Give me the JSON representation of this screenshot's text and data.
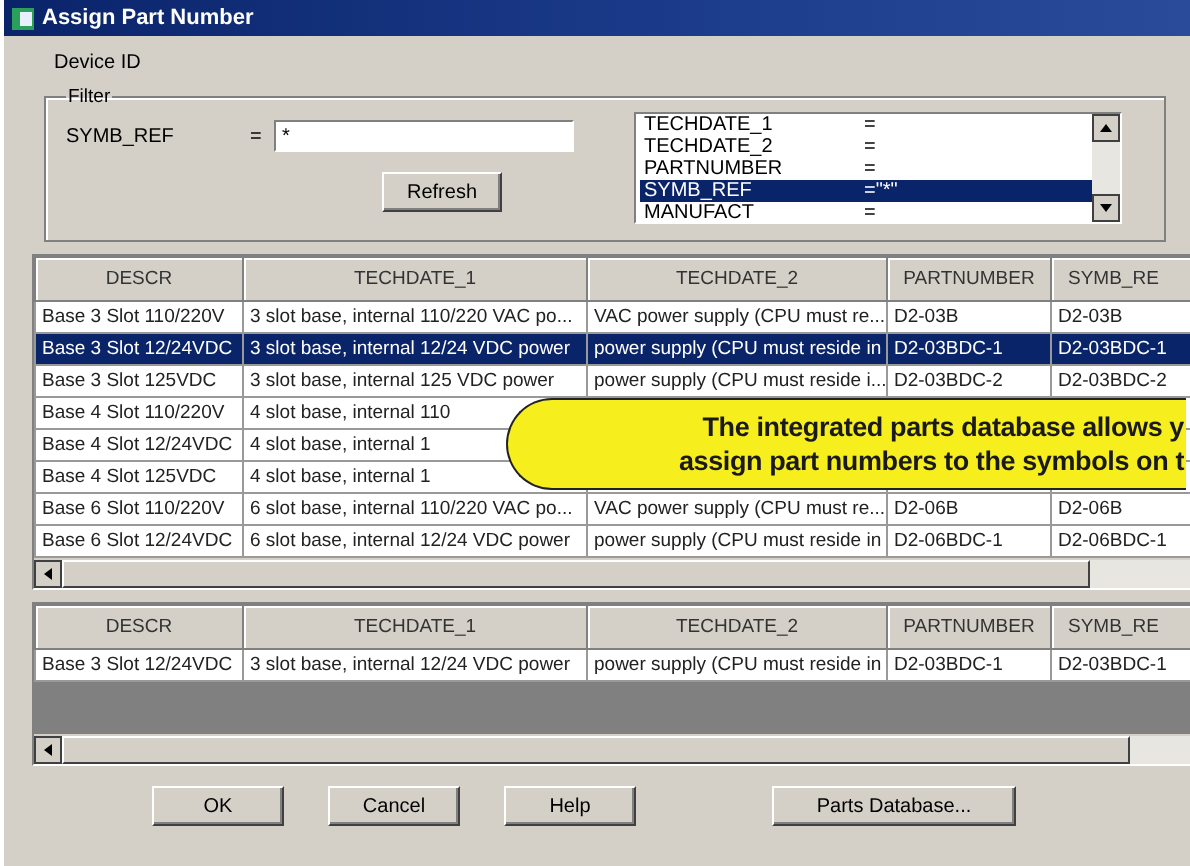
{
  "window": {
    "title": "Assign Part Number"
  },
  "device_id_label": "Device ID",
  "filter": {
    "title": "Filter",
    "field_label": "SYMB_REF",
    "equals": "=",
    "value": "*",
    "refresh_button": "Refresh",
    "conditions": [
      {
        "name": "TECHDATE_1",
        "operator": "=",
        "selected": false
      },
      {
        "name": "TECHDATE_2",
        "operator": "=",
        "selected": false
      },
      {
        "name": "PARTNUMBER",
        "operator": "=",
        "selected": false
      },
      {
        "name": "SYMB_REF",
        "operator": "=\"*\"",
        "selected": true
      },
      {
        "name": "MANUFACT",
        "operator": "=",
        "selected": false
      }
    ]
  },
  "parts_table": {
    "columns": [
      "DESCR",
      "TECHDATE_1",
      "TECHDATE_2",
      "PARTNUMBER",
      "SYMB_RE"
    ],
    "rows": [
      {
        "cells": [
          "Base 3 Slot 110/220V",
          "3 slot base, internal 110/220 VAC po...",
          "VAC power supply (CPU must re...",
          "D2-03B",
          "D2-03B"
        ],
        "selected": false
      },
      {
        "cells": [
          "Base 3 Slot 12/24VDC",
          "3 slot base, internal 12/24 VDC power",
          "power supply (CPU must reside in",
          "D2-03BDC-1",
          "D2-03BDC-1"
        ],
        "selected": true
      },
      {
        "cells": [
          "Base 3 Slot 125VDC",
          "3 slot base, internal 125 VDC power",
          "power supply (CPU must reside i...",
          "D2-03BDC-2",
          "D2-03BDC-2"
        ],
        "selected": false
      },
      {
        "cells": [
          "Base 4 Slot 110/220V",
          "4 slot base, internal 110"
        ],
        "selected": false
      },
      {
        "cells": [
          "Base 4 Slot 12/24VDC",
          "4 slot base, internal 1"
        ],
        "selected": false
      },
      {
        "cells": [
          "Base 4 Slot 125VDC",
          "4 slot base, internal 1"
        ],
        "selected": false
      },
      {
        "cells": [
          "Base 6 Slot 110/220V",
          "6 slot base, internal 110/220 VAC po...",
          "VAC power supply (CPU must re...",
          "D2-06B",
          "D2-06B"
        ],
        "selected": false
      },
      {
        "cells": [
          "Base 6 Slot 12/24VDC",
          "6 slot base, internal 12/24 VDC power",
          "power supply (CPU must reside in",
          "D2-06BDC-1",
          "D2-06BDC-1"
        ],
        "selected": false
      }
    ]
  },
  "assigned_table": {
    "columns": [
      "DESCR",
      "TECHDATE_1",
      "TECHDATE_2",
      "PARTNUMBER",
      "SYMB_RE"
    ],
    "rows": [
      {
        "cells": [
          "Base 3 Slot 12/24VDC",
          "3 slot base, internal 12/24 VDC power",
          "power supply (CPU must reside in",
          "D2-03BDC-1",
          "D2-03BDC-1"
        ],
        "selected": false
      }
    ]
  },
  "buttons": [
    "OK",
    "Cancel",
    "Help",
    "Parts Database..."
  ],
  "callout": {
    "lines": [
      "The integrated parts database allows y",
      "assign part numbers to the symbols on t"
    ]
  }
}
